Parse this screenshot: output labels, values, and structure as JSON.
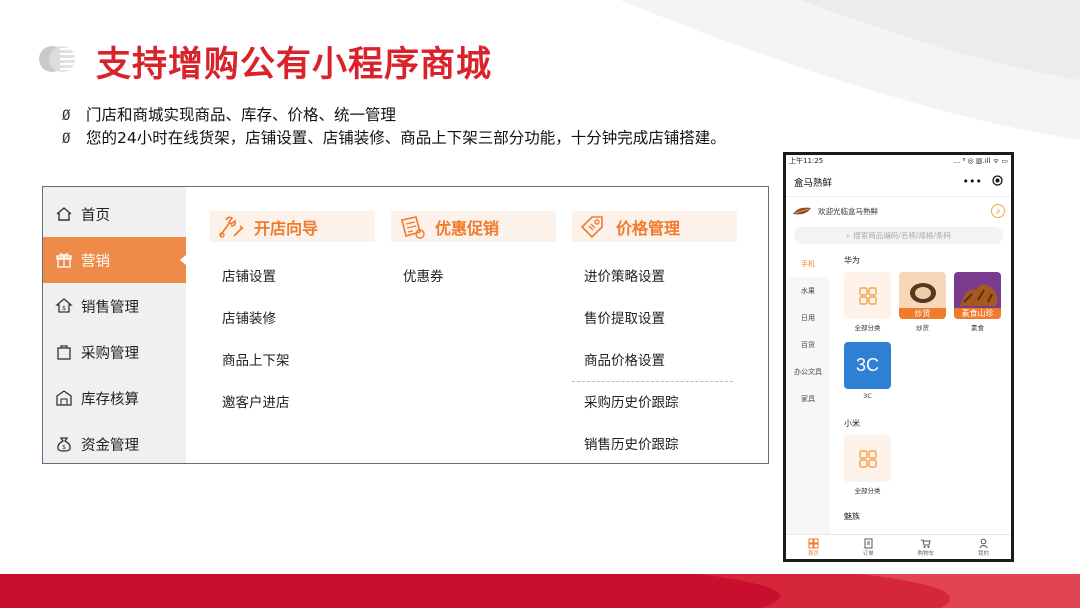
{
  "slide": {
    "title": "支持增购公有小程序商城",
    "bullet_mark": "Ø",
    "bullets": [
      "门店和商城实现商品、库存、价格、统一管理",
      "您的24小时在线货架，店铺设置、店铺装修、商品上下架三部分功能，十分钟完成店铺搭建。"
    ]
  },
  "colors": {
    "title_red": "#d9232b",
    "accent_orange": "#ee8b48",
    "band_red": "#c8102e"
  },
  "sidebar": {
    "items": [
      {
        "label": "首页",
        "icon": "home-icon"
      },
      {
        "label": "营销",
        "icon": "gift-icon",
        "active": true
      },
      {
        "label": "销售管理",
        "icon": "sales-icon"
      },
      {
        "label": "采购管理",
        "icon": "purchase-icon"
      },
      {
        "label": "库存核算",
        "icon": "inventory-icon"
      },
      {
        "label": "资金管理",
        "icon": "money-bag-icon"
      }
    ]
  },
  "columns": [
    {
      "title": "开店向导",
      "icon": "wrench-tools-icon",
      "items": [
        "店铺设置",
        "店铺装修",
        "商品上下架",
        "邀客户进店"
      ]
    },
    {
      "title": "优惠促销",
      "icon": "coupon-icon",
      "items": [
        "优惠券"
      ]
    },
    {
      "title": "价格管理",
      "icon": "price-tag-icon",
      "items": [
        "进价策略设置",
        "售价提取设置",
        "商品价格设置",
        "采购历史价跟踪",
        "销售历史价跟踪"
      ]
    }
  ],
  "phone": {
    "status_time": "上午11:25",
    "status_right": "... ⁸ ◎ ▥.ıll ᯤ ▭",
    "shop_name": "盒马熟鲜",
    "more_label": "•••",
    "welcome": "欢迎光临盒马熟鲜",
    "search_placeholder": "搜索商品编码/名称/规格/条码",
    "categories": [
      "手机",
      "水果",
      "日用",
      "百货",
      "办公文具",
      "家具"
    ],
    "brands": [
      {
        "name": "华为",
        "tiles": [
          {
            "caption": "全部分类",
            "kind": "grid"
          },
          {
            "caption": "炒货",
            "tag": "炒货",
            "kind": "nut"
          },
          {
            "caption": "素食",
            "tag": "素食山珍",
            "kind": "mushroom"
          }
        ]
      },
      {
        "name": "",
        "tiles": [
          {
            "caption": "3C",
            "kind": "3c",
            "badge": "3C"
          }
        ]
      },
      {
        "name": "小米",
        "tiles": [
          {
            "caption": "全部分类",
            "kind": "grid"
          }
        ]
      },
      {
        "name": "魅族",
        "tiles": []
      }
    ],
    "tabs": [
      {
        "label": "首页",
        "icon": "home-grid-icon",
        "active": true
      },
      {
        "label": "订单",
        "icon": "order-icon"
      },
      {
        "label": "购物车",
        "icon": "cart-icon"
      },
      {
        "label": "我的",
        "icon": "user-icon"
      }
    ]
  }
}
